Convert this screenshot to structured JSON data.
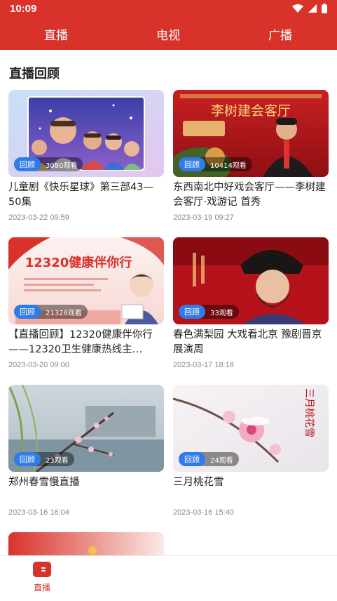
{
  "status": {
    "time": "10:09"
  },
  "tabs": [
    {
      "label": "直播"
    },
    {
      "label": "电视"
    },
    {
      "label": "广播"
    }
  ],
  "section": {
    "title": "直播回顾"
  },
  "cards": [
    {
      "tag": "回顾",
      "views": "3080观看",
      "title": "儿童剧《快乐星球》第三部43—50集",
      "date": "2023-03-22 09:59"
    },
    {
      "tag": "回顾",
      "views": "10414观看",
      "title": "东西南北中好戏会客厅——李树建会客厅·戏游记 首秀",
      "date": "2023-03-19 09:27",
      "thumb_text": "李树建会客厅"
    },
    {
      "tag": "回顾",
      "views": "21328观看",
      "title": "【直播回顾】12320健康伴你行——12320卫生健康热线主…",
      "date": "2023-03-20 09:00",
      "thumb_text": "12320健康伴你行"
    },
    {
      "tag": "回顾",
      "views": "33观看",
      "title": "春色满梨园 大戏看北京 豫剧晋京展演周",
      "date": "2023-03-17 18:18"
    },
    {
      "tag": "回顾",
      "views": "23观看",
      "title": "郑州春雪慢直播",
      "date": "2023-03-16 16:04"
    },
    {
      "tag": "回顾",
      "views": "24观看",
      "title": "三月桃花雪",
      "date": "2023-03-16 15:40",
      "thumb_text": "三月桃花雪"
    }
  ],
  "bottom_nav": {
    "label": "直播"
  },
  "colors": {
    "brand": "#d8322b",
    "tag": "#2f7be8"
  }
}
